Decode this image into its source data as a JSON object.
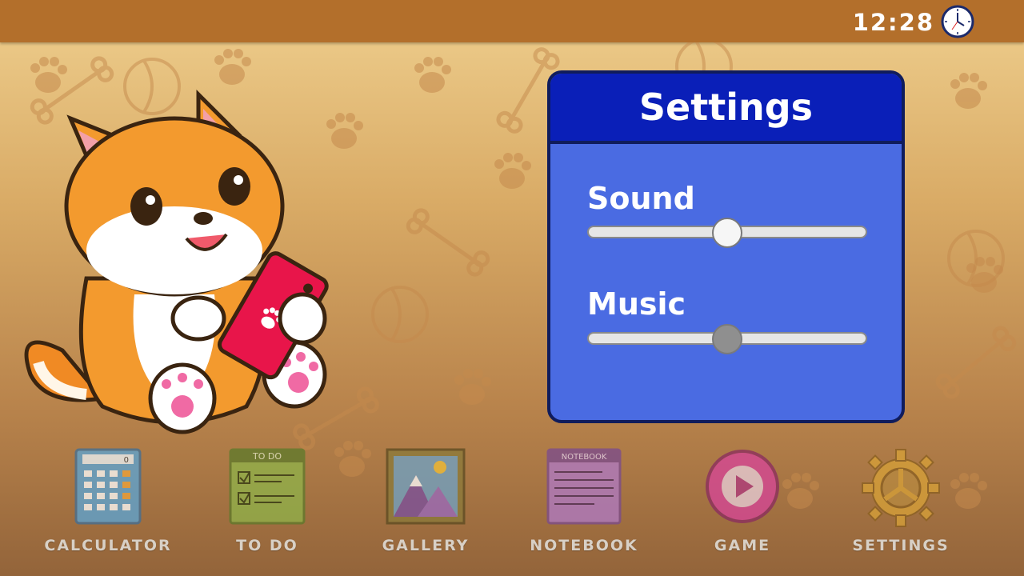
{
  "status_bar": {
    "time": "12:28",
    "clock_icon": "analog-clock-icon"
  },
  "settings_panel": {
    "title": "Settings",
    "sound": {
      "label": "Sound",
      "level_percent": 50
    },
    "music": {
      "label": "Music",
      "level_percent": 50
    }
  },
  "mascot": "shiba-dog-with-phone",
  "dock": [
    {
      "label": "CALCULATOR",
      "icon": "calculator-icon",
      "display_value": "0"
    },
    {
      "label": "TO DO",
      "icon": "todo-list-icon",
      "header": "TO DO"
    },
    {
      "label": "GALLERY",
      "icon": "gallery-icon"
    },
    {
      "label": "NOTEBOOK",
      "icon": "notebook-icon",
      "header": "NOTEBOOK"
    },
    {
      "label": "GAME",
      "icon": "play-icon"
    },
    {
      "label": "SETTINGS",
      "icon": "gear-icon"
    }
  ],
  "colors": {
    "top_bar": "#b36f2b",
    "panel_header": "#0a1fb8",
    "panel_body": "#4a6be2",
    "dock_label": "#d8d0c6"
  }
}
